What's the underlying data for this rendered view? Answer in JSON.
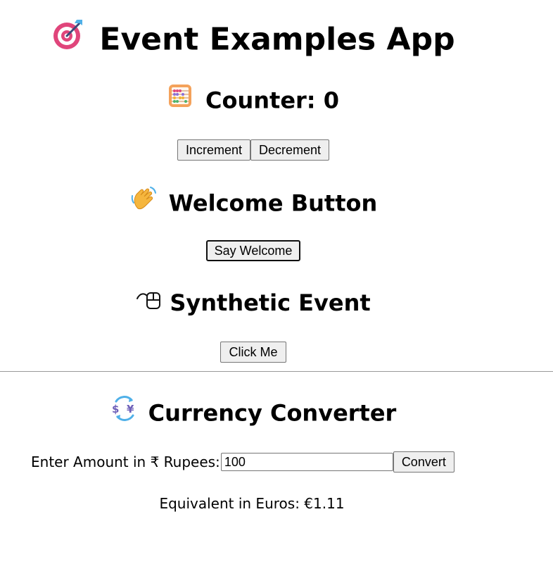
{
  "app": {
    "title": "Event Examples App",
    "title_icon": "bullseye-dart-icon"
  },
  "counter": {
    "heading": "Counter: 0",
    "icon": "abacus-icon",
    "increment_label": "Increment",
    "decrement_label": "Decrement"
  },
  "welcome": {
    "heading": "Welcome Button",
    "icon": "waving-hand-icon",
    "button_label": "Say Welcome"
  },
  "synthetic": {
    "heading": "Synthetic Event",
    "icon": "computer-mouse-icon",
    "button_label": "Click Me"
  },
  "currency": {
    "heading": "Currency Converter",
    "icon": "currency-exchange-icon",
    "amount_label": "Enter Amount in ₹ Rupees:",
    "amount_value": "100",
    "convert_label": "Convert",
    "result_text": "Equivalent in Euros: €1.11"
  }
}
